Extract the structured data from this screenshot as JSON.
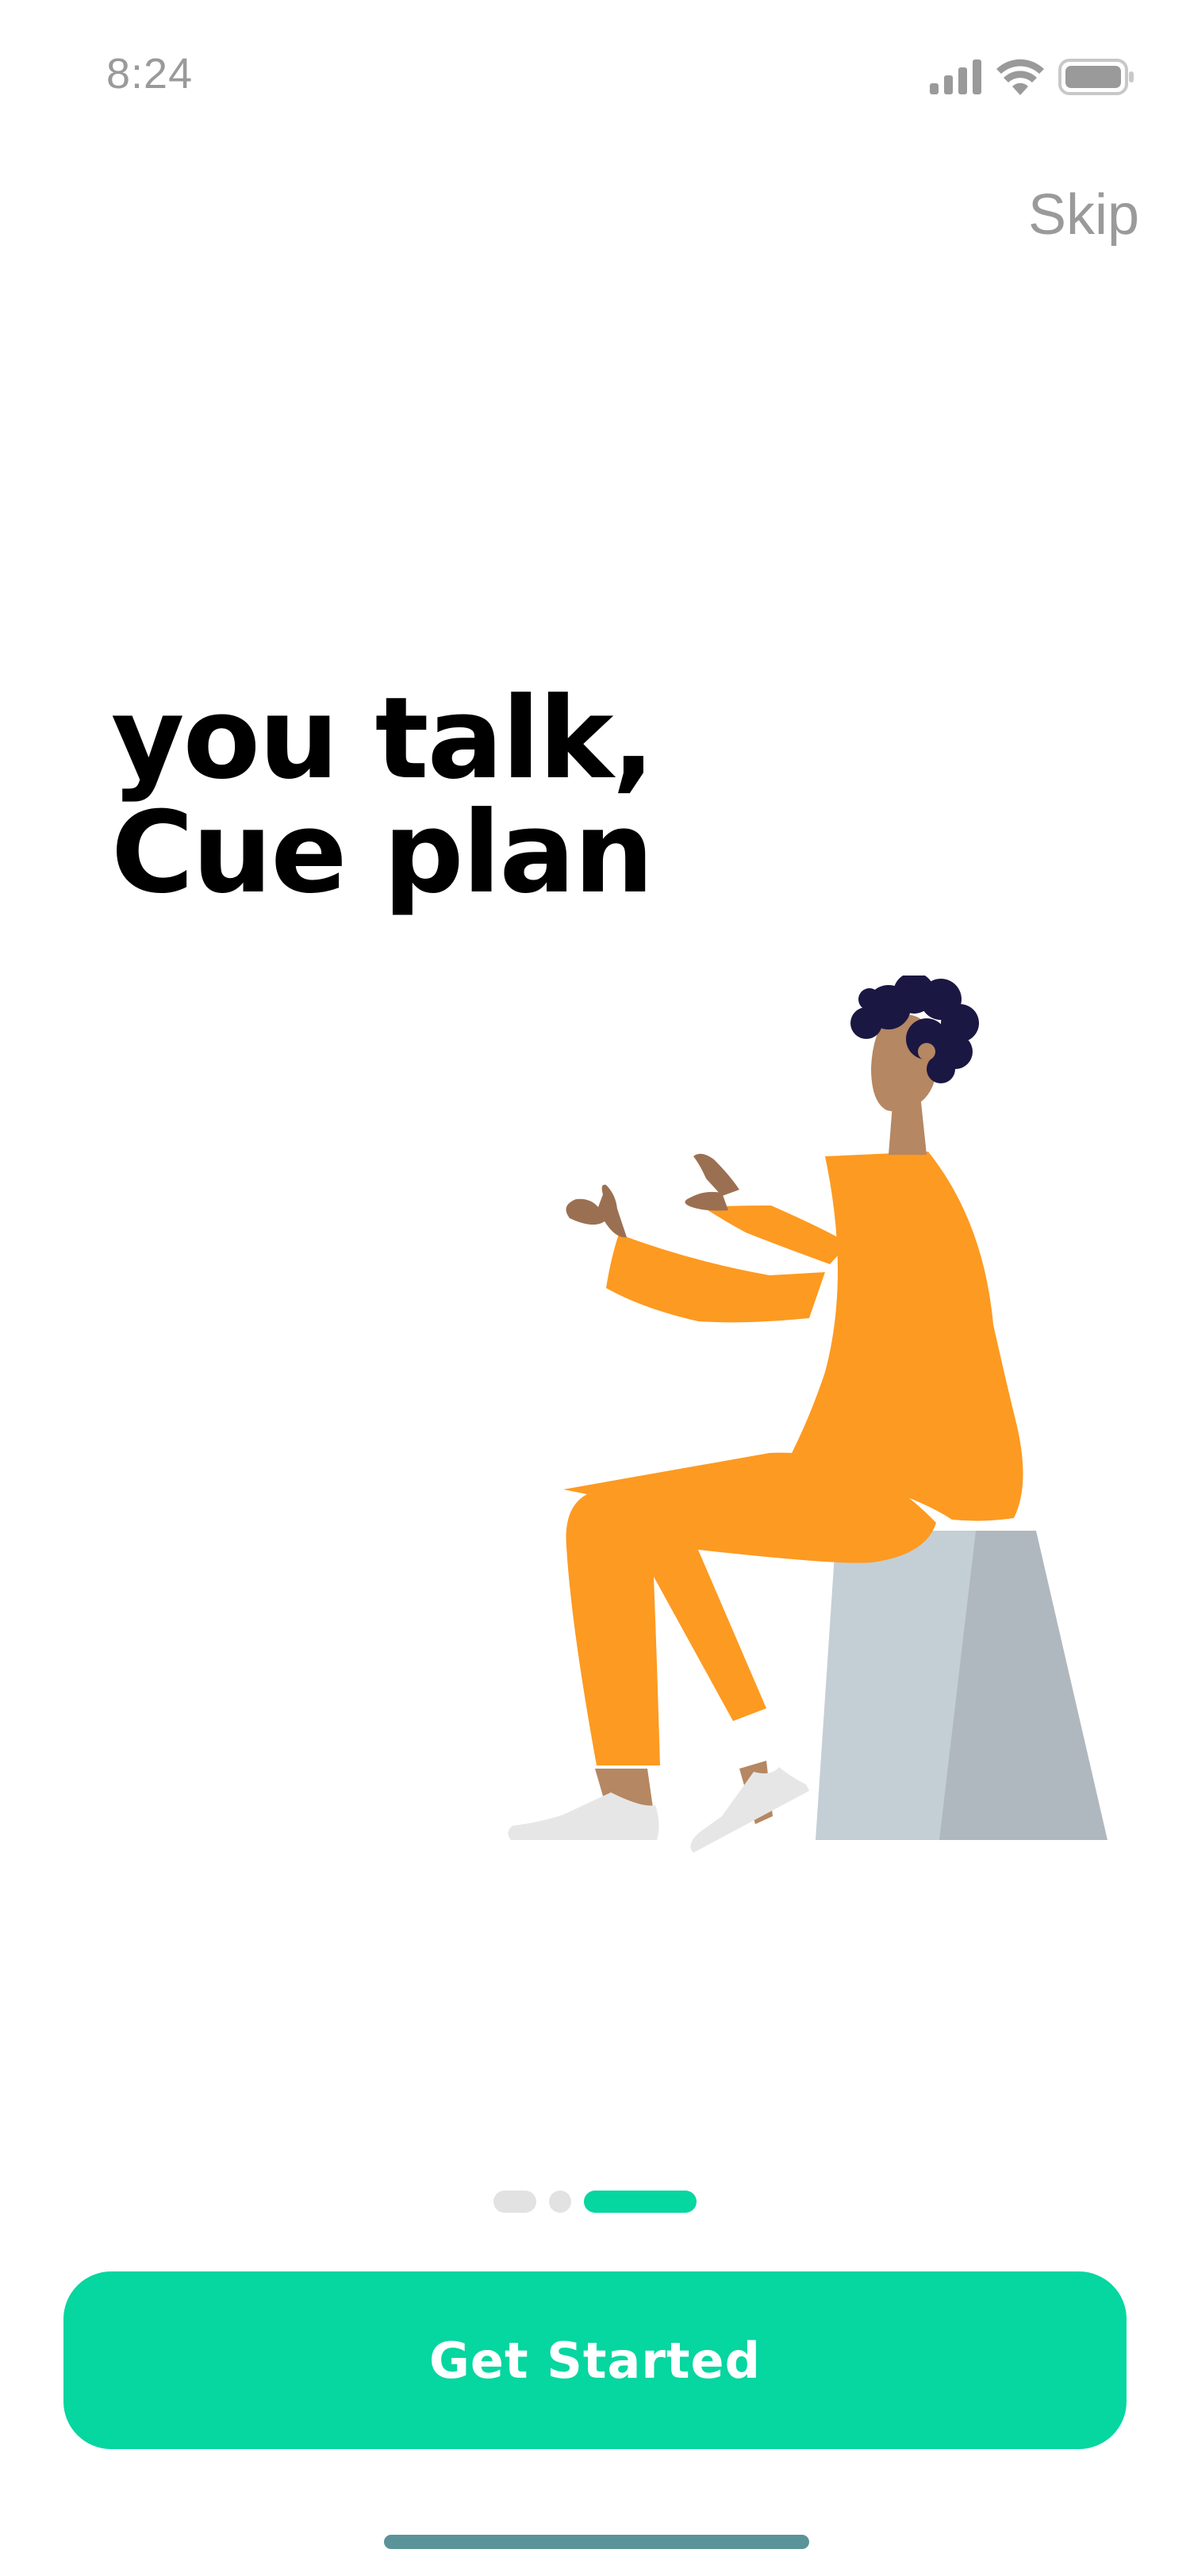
{
  "status_bar": {
    "time": "8:24",
    "icons": [
      "signal-icon",
      "wifi-icon",
      "battery-icon"
    ]
  },
  "header": {
    "skip_label": "Skip"
  },
  "hero": {
    "line1": "you talk,",
    "line2": "Cue plan"
  },
  "illustration": {
    "name": "person-sitting-talking-illustration",
    "colors": {
      "outfit": "#fd9a21",
      "hair": "#1b1743",
      "skin": "#b58762",
      "hand": "#9b7052",
      "stool_light": "#c4ced5",
      "stool_dark": "#b0b8bf",
      "shoes": "#e6e6e6"
    }
  },
  "pager": {
    "current_page": 3,
    "total_pages": 3
  },
  "cta": {
    "label": "Get Started"
  },
  "colors": {
    "accent": "#06d6a0",
    "muted_text": "#9a9a9a",
    "inactive_dot": "#e2e2e2",
    "home_indicator": "#5a9498"
  }
}
